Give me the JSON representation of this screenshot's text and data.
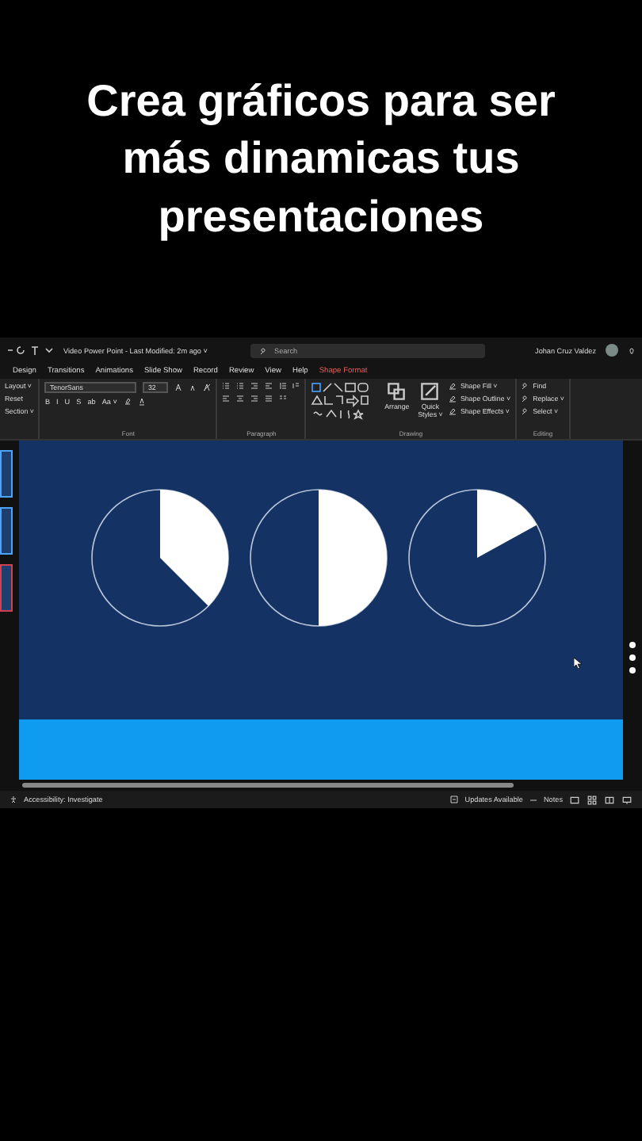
{
  "caption": "Crea gráficos para ser más dinamicas tus presentaciones",
  "title_bar": {
    "document": "Video Power Point - Last Modified: 2m ago ˅",
    "search_placeholder": "Search",
    "user": "Johan Cruz Valdez"
  },
  "tabs": [
    {
      "label": "Design",
      "selected": false
    },
    {
      "label": "Transitions",
      "selected": false
    },
    {
      "label": "Animations",
      "selected": false
    },
    {
      "label": "Slide Show",
      "selected": false
    },
    {
      "label": "Record",
      "selected": false
    },
    {
      "label": "Review",
      "selected": false
    },
    {
      "label": "View",
      "selected": false
    },
    {
      "label": "Help",
      "selected": false
    },
    {
      "label": "Shape Format",
      "selected": true
    }
  ],
  "ribbon": {
    "slides": [
      "Layout ˅",
      "Reset",
      "Section ˅"
    ],
    "font": {
      "name": "TenorSans",
      "size": "32",
      "format_buttons": [
        "B",
        "I",
        "U",
        "S",
        "ab",
        "Aa ˅"
      ],
      "label": "Font"
    },
    "paragraph": {
      "label": "Paragraph"
    },
    "drawing": {
      "arrange": "Arrange",
      "quick_styles": "Quick Styles ˅",
      "shape_commands": [
        "Shape Fill ˅",
        "Shape Outline ˅",
        "Shape Effects ˅"
      ],
      "label": "Drawing"
    },
    "editing": {
      "commands": [
        "Find",
        "Replace ˅",
        "Select ˅"
      ],
      "label": "Editing"
    }
  },
  "status_bar": {
    "accessibility": "Accessibility: Investigate",
    "updates": "Updates Available",
    "notes": "Notes"
  }
}
